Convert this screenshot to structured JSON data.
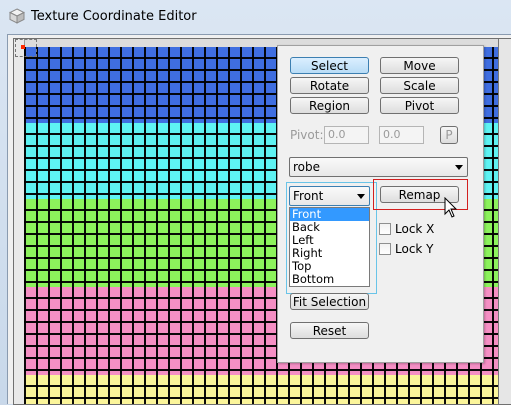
{
  "window": {
    "title": "Texture Coordinate Editor",
    "app_icon": "cube-icon"
  },
  "panel": {
    "buttons": {
      "select": "Select",
      "move": "Move",
      "rotate": "Rotate",
      "scale": "Scale",
      "region": "Region",
      "pivot": "Pivot",
      "remap": "Remap",
      "fit_selection": "Fit Selection",
      "reset": "Reset"
    },
    "pivot_row": {
      "label": "Pivot:",
      "x_value": "0.0",
      "y_value": "0.0",
      "p_button": "P"
    },
    "material_select": {
      "value": "robe"
    },
    "projection_select": {
      "value": "Front",
      "options": [
        "Front",
        "Back",
        "Left",
        "Right",
        "Top",
        "Bottom"
      ],
      "highlighted": "Front"
    },
    "lock_x": {
      "label": "Lock X",
      "checked": false
    },
    "lock_y": {
      "label": "Lock Y",
      "checked": false
    }
  },
  "colors": {
    "band_blue": "#3f6ee0",
    "band_cyan": "#5ef3f3",
    "band_green": "#8cf25c",
    "band_pink": "#f58fc4",
    "band_yellow": "#fbf59a",
    "highlight_red": "#d21f1f",
    "highlight_blue": "#69c4e8",
    "selection_blue": "#3399ff"
  }
}
